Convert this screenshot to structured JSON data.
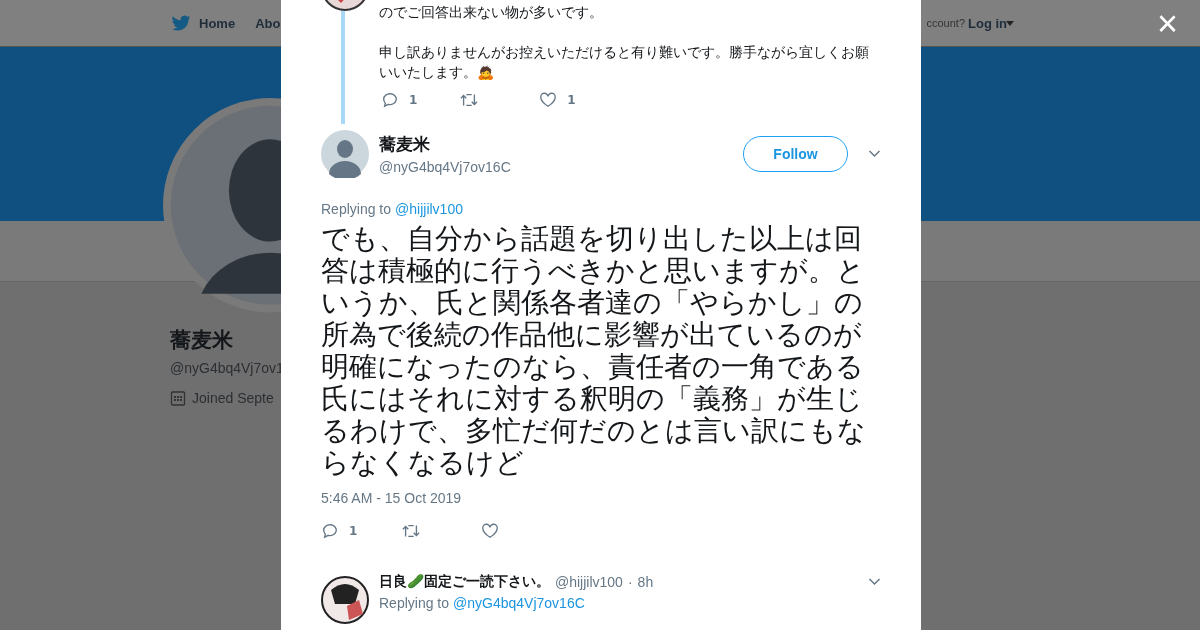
{
  "nav": {
    "home": "Home",
    "about": "Abo",
    "account": "ccount?",
    "login": "Log in"
  },
  "profile": {
    "name": "蕎麦米",
    "handle": "@nyG4bq4Vj7ov1",
    "joined": "Joined Septe"
  },
  "close": "×",
  "previous_tweet": {
    "lines": [
      "のでご回答出来ない物が多いです。",
      "申し訳ありませんがお控えいただけると有り難いです。勝手ながら宜しくお願いいたします。🙇"
    ],
    "replies": "1",
    "likes": "1"
  },
  "tweet": {
    "name": "蕎麦米",
    "handle": "@nyG4bq4Vj7ov16C",
    "follow": "Follow",
    "replying_label": "Replying to",
    "replying_to": "@hijjilv100",
    "text": "でも、自分から話題を切り出した以上は回答は積極的に行うべきかと思いますが。というか、氏と関係各者達の「やらかし」の所為で後続の作品他に影響が出ているのが明確になったのなら、責任者の一角である氏にはそれに対する釈明の「義務」が生じるわけで、多忙だ何だのとは言い訳にもならなくなるけど",
    "time": "5:46 AM - 15 Oct 2019",
    "replies": "1"
  },
  "reply": {
    "name": "日良🥒固定ご一読下さい。",
    "handle": "@hijjilv100",
    "separator": "·",
    "age": "8h",
    "replying_label": "Replying to",
    "replying_to": "@nyG4bq4Vj7ov16C"
  }
}
